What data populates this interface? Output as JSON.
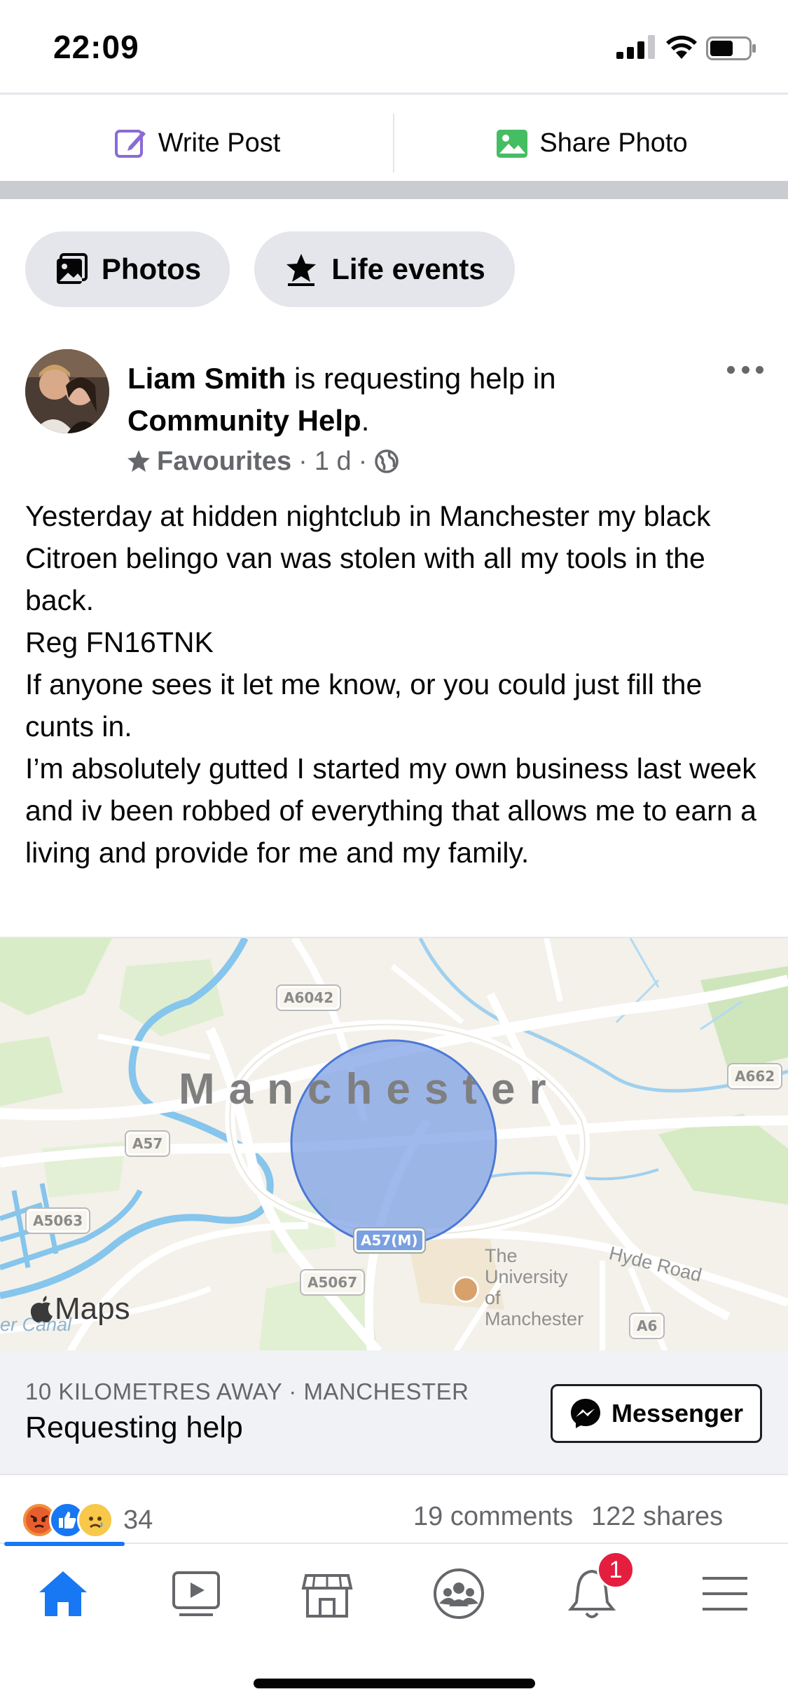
{
  "status_bar": {
    "time": "22:09"
  },
  "composer": {
    "write_post": "Write Post",
    "share_photo": "Share Photo"
  },
  "chips": {
    "photos": "Photos",
    "life_events": "Life events"
  },
  "post": {
    "author": "Liam Smith",
    "action": "is requesting help in",
    "group": "Community Help",
    "group_suffix": ".",
    "meta": {
      "audience": "Favourites",
      "time": "1 d",
      "separator": "·"
    },
    "body": [
      "Yesterday at hidden nightclub in Manchester my black Citroen belingo van was stolen with all my tools in the back.",
      "Reg FN16TNK",
      "If anyone sees it let me know, or you could just fill the cunts in.",
      "I’m absolutely gutted I started my own business last week and iv been robbed of everything that allows me to earn a living and provide for me and my family."
    ]
  },
  "map": {
    "city_label": "Manchester",
    "road_labels": [
      "A6042",
      "A57",
      "A5063",
      "A662",
      "A57(M)",
      "A5067",
      "A6"
    ],
    "university_label": [
      "The",
      "University",
      "of",
      "Manchester"
    ],
    "hyde_road": "Hyde Road",
    "canal_fragment": "er Canal",
    "brand": "Maps",
    "colors": {
      "radius_fill": "#7a9ee6",
      "radius_stroke": "#4a78d6",
      "water": "#7cc0ea"
    }
  },
  "request": {
    "meta": "10 KILOMETRES AWAY · MANCHESTER",
    "title": "Requesting help",
    "messenger_label": "Messenger"
  },
  "engagement": {
    "reactions": [
      "angry",
      "like",
      "sad"
    ],
    "reaction_count": "34",
    "comments": "19 comments",
    "shares": "122 shares"
  },
  "nav": {
    "items": [
      "home",
      "watch",
      "marketplace",
      "groups",
      "notifications",
      "menu"
    ],
    "active": "home",
    "notification_badge": "1",
    "accent": "#1877f2"
  }
}
